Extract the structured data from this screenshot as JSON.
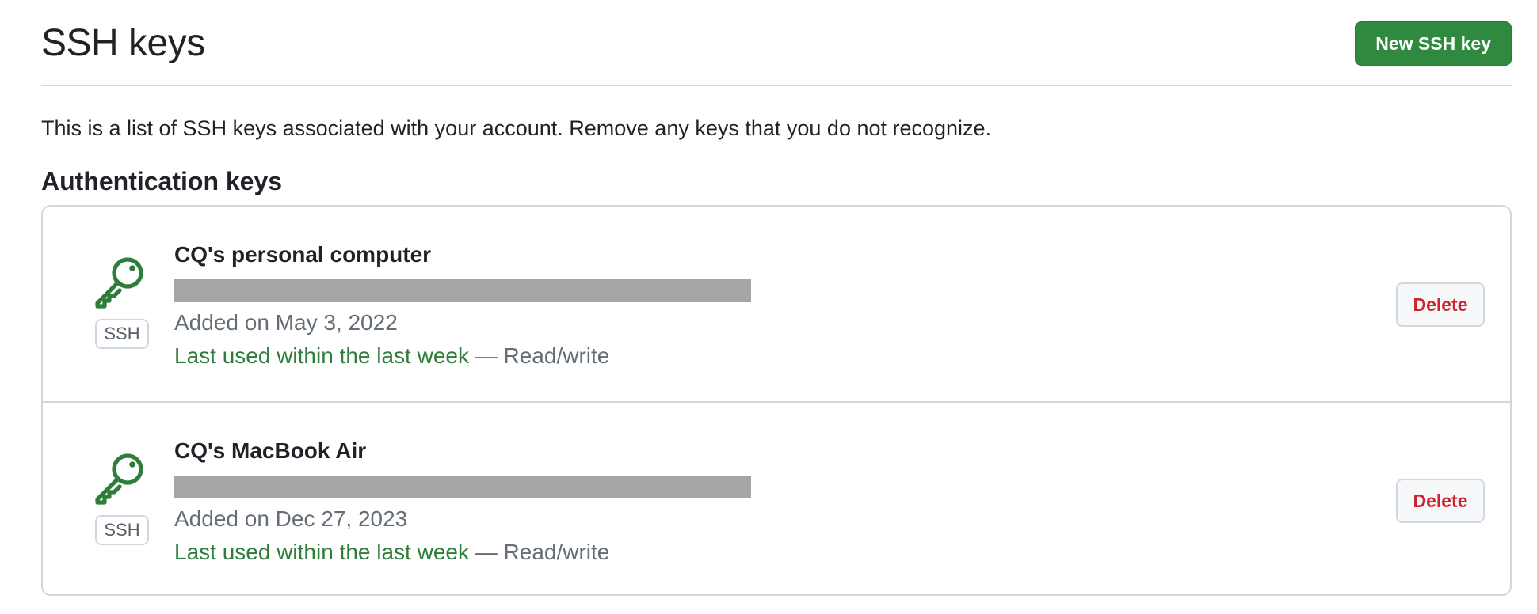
{
  "header": {
    "title": "SSH keys",
    "new_key_label": "New SSH key"
  },
  "intro": "This is a list of SSH keys associated with your account. Remove any keys that you do not recognize.",
  "section": {
    "title": "Authentication keys"
  },
  "keys": [
    {
      "icon": "key-icon",
      "badge": "SSH",
      "title": "CQ's personal computer",
      "fingerprint_redacted": true,
      "added": "Added on May 3, 2022",
      "last_used": "Last used within the last week",
      "access": "— Read/write",
      "delete_label": "Delete"
    },
    {
      "icon": "key-icon",
      "badge": "SSH",
      "title": "CQ's MacBook Air",
      "fingerprint_redacted": true,
      "added": "Added on Dec 27, 2023",
      "last_used": "Last used within the last week",
      "access": "— Read/write",
      "delete_label": "Delete"
    }
  ],
  "colors": {
    "primary_button": "#2f8a3f",
    "success_text": "#2f7d3a",
    "danger_text": "#cf222e",
    "muted_text": "#656d76",
    "border": "#d0d7de",
    "redaction": "#a6a6a6"
  }
}
